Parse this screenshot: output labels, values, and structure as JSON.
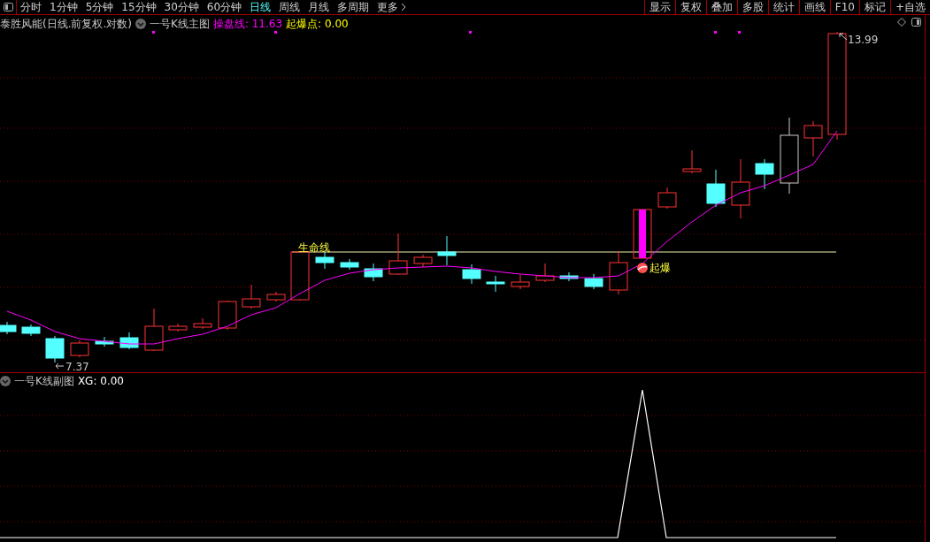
{
  "toolbar": {
    "periods": [
      {
        "label": "分时",
        "selected": false
      },
      {
        "label": "1分钟",
        "selected": false
      },
      {
        "label": "5分钟",
        "selected": false
      },
      {
        "label": "15分钟",
        "selected": false
      },
      {
        "label": "30分钟",
        "selected": false
      },
      {
        "label": "60分钟",
        "selected": false
      },
      {
        "label": "日线",
        "selected": true
      },
      {
        "label": "周线",
        "selected": false
      },
      {
        "label": "月线",
        "selected": false
      },
      {
        "label": "多周期",
        "selected": false
      },
      {
        "label": "更多",
        "selected": false
      }
    ],
    "buttons": [
      "显示",
      "复权",
      "叠加",
      "多股",
      "统计",
      "画线",
      "F10",
      "标记",
      "+自选"
    ]
  },
  "main_chart": {
    "title": "泰胜风能(日线.前复权.对数)",
    "indicator": "一号K线主图",
    "values": [
      {
        "label": "操盘线: 11.63",
        "color": "#ff00ff"
      },
      {
        "label": "起爆点: 0.00",
        "color": "#ffff00"
      }
    ],
    "annotations": {
      "life_line": "生命线",
      "burst": "起爆",
      "high": "13.99",
      "low": "7.37"
    }
  },
  "sub_chart": {
    "indicator": "一号K线副图",
    "values": [
      {
        "label": "XG: 0.00",
        "color": "#ffffff"
      }
    ]
  }
}
